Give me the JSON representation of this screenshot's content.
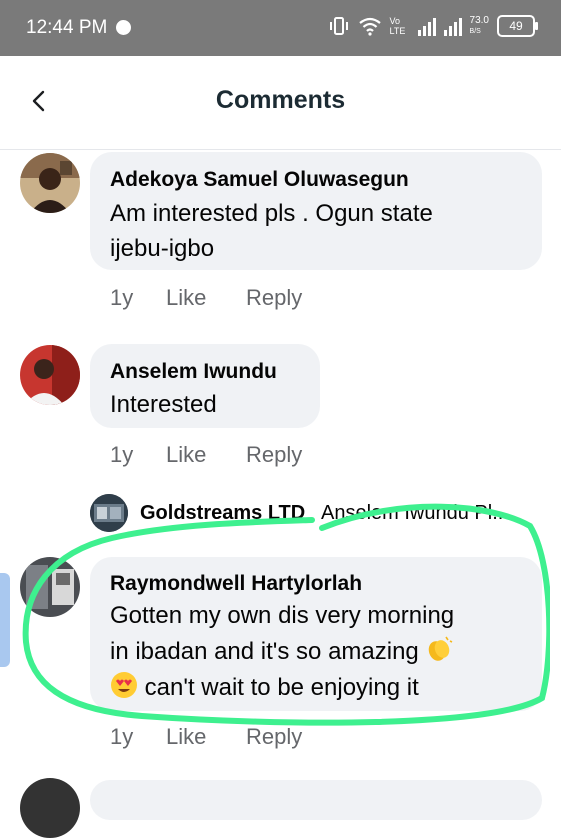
{
  "status_bar": {
    "time": "12:44 PM",
    "net_speed": "73.0",
    "net_unit": "B/S",
    "volte": "Vo LTE",
    "battery": "49"
  },
  "header": {
    "title": "Comments",
    "back_icon": "chevron-left-icon"
  },
  "comments": [
    {
      "author": "Adekoya Samuel Oluwasegun",
      "text_line1": "Am interested pls . Ogun state",
      "text_line2": "ijebu-igbo",
      "time": "1y",
      "like": "Like",
      "reply": "Reply"
    },
    {
      "author": "Anselem Iwundu",
      "text_line1": "Interested",
      "time": "1y",
      "like": "Like",
      "reply": "Reply",
      "reply_preview": {
        "author": "Goldstreams LTD",
        "text": "Anselem Iwundu Pl..."
      }
    },
    {
      "author": "Raymondwell Hartylorlah",
      "text_line1": "Gotten my own dis very morning",
      "text_line2": "in ibadan and it's so amazing",
      "text_line3": "can't wait to be enjoying it",
      "time": "1y",
      "like": "Like",
      "reply": "Reply"
    }
  ],
  "colors": {
    "highlight": "#3ef08f",
    "bubble": "#f0f2f5",
    "secondary_text": "#65676b"
  }
}
